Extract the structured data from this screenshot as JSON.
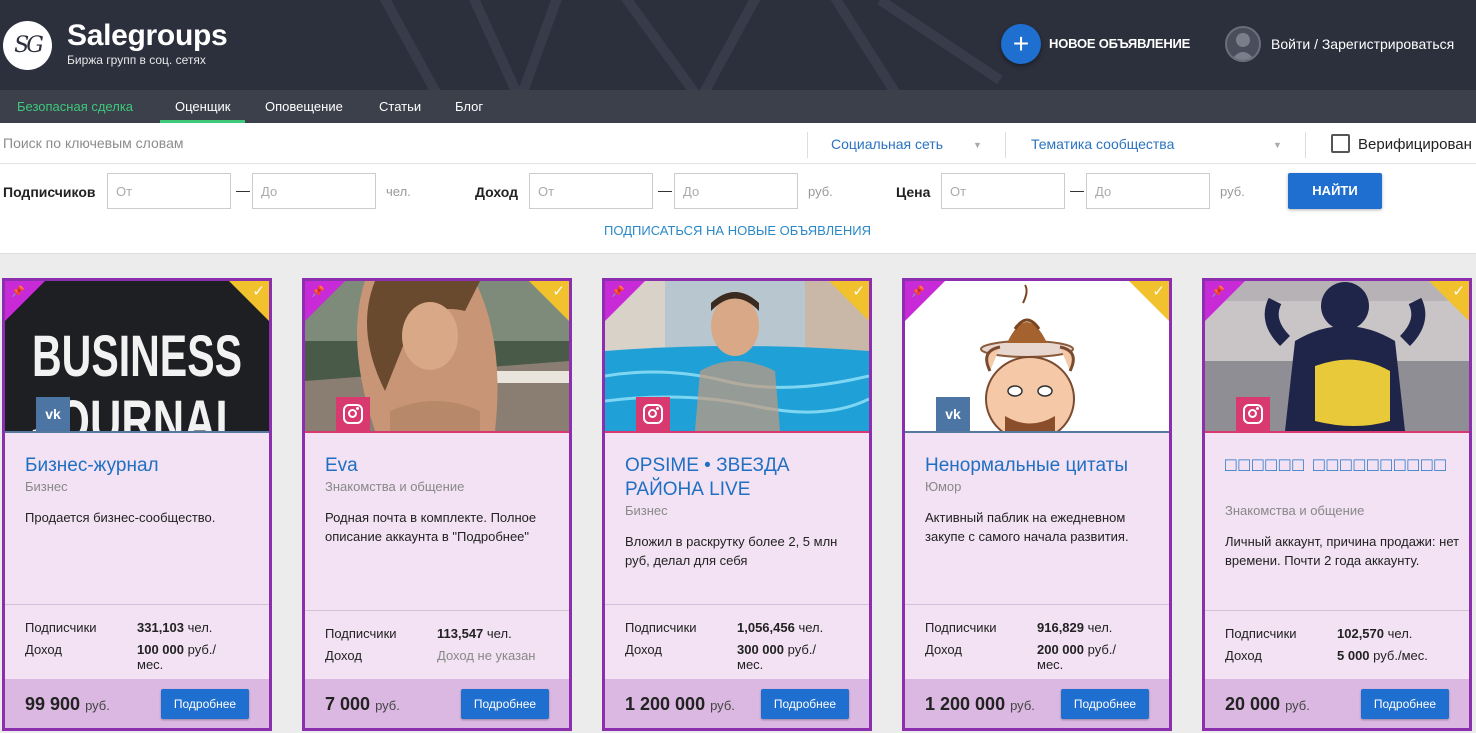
{
  "header": {
    "logo_text": "SG",
    "brand": "Salegroups",
    "tagline": "Биржа групп в соц. сетях",
    "new_ad_icon": "+",
    "new_ad_label": "НОВОЕ ОБЪЯВЛЕНИЕ",
    "login_label": "Войти / Зарегистрироваться"
  },
  "nav": {
    "items": [
      {
        "label": "Безопасная сделка"
      },
      {
        "label": "Оценщик"
      },
      {
        "label": "Оповещение"
      },
      {
        "label": "Статьи"
      },
      {
        "label": "Блог"
      }
    ]
  },
  "filters": {
    "search_placeholder": "Поиск по ключевым словам",
    "social_select": "Социальная сеть",
    "topic_select": "Тематика сообщества",
    "verified_label": "Верифицирован",
    "caret": "▼",
    "dash": "—",
    "subscribers": {
      "label": "Подписчиков",
      "from": "От",
      "to": "До",
      "unit": "чел."
    },
    "income": {
      "label": "Доход",
      "from": "От",
      "to": "До",
      "unit": "руб."
    },
    "price": {
      "label": "Цена",
      "from": "От",
      "to": "До",
      "unit": "руб."
    },
    "search_button": "НАЙТИ",
    "subscribe_link": "ПОДПИСАТЬСЯ НА НОВЫЕ ОБЪЯВЛЕНИЯ"
  },
  "card_labels": {
    "subscribers": "Подписчики",
    "income": "Доход",
    "more": "Подробнее",
    "currency": "руб.",
    "pin_icon": "📌",
    "check_icon": "✓"
  },
  "cards": [
    {
      "network": "vk",
      "network_icon": "vk",
      "title": "Бизнес-журнал",
      "category": "Бизнес",
      "description": "Продается бизнес-сообщество.",
      "subscribers": "331,103",
      "subscribers_unit": "чел.",
      "income": "100 000",
      "income_unit": "руб./ мес.",
      "price": "99 900",
      "image_text_1": "BUSINESS",
      "image_text_2": "JOURNAL"
    },
    {
      "network": "instagram",
      "network_icon": "instagram",
      "title": "Eva",
      "category": "Знакомства и общение",
      "description": "Родная почта в комплекте. Полное описание аккаунта в \"Подробнее\"",
      "subscribers": "113,547",
      "subscribers_unit": "чел.",
      "income": "Доход не указан",
      "income_unit": "",
      "price": "7 000"
    },
    {
      "network": "instagram",
      "network_icon": "instagram",
      "title": "OPSIME • ЗВЕЗДА РАЙОНА LIVE",
      "category": "Бизнес",
      "description": "Вложил в раскрутку более 2, 5 млн руб, делал для себя",
      "subscribers": "1,056,456",
      "subscribers_unit": "чел.",
      "income": "300 000",
      "income_unit": "руб./ мес.",
      "price": "1 200 000"
    },
    {
      "network": "vk",
      "network_icon": "vk",
      "title": "Ненормальные цитаты",
      "category": "Юмор",
      "description": "Активный паблик на ежедневном закупе с самого начала развития.",
      "subscribers": "916,829",
      "subscribers_unit": "чел.",
      "income": "200 000",
      "income_unit": "руб./ мес.",
      "price": "1 200 000"
    },
    {
      "network": "instagram",
      "network_icon": "instagram",
      "title": "□□□□□□ □□□□□□□□□□",
      "category": "Знакомства и общение",
      "description": "Личный аккаунт, причина продажи: нет времени. Почти 2 года аккаунту.",
      "subscribers": "102,570",
      "subscribers_unit": "чел.",
      "income": "5 000",
      "income_unit": "руб./мес.",
      "price": "20 000"
    }
  ]
}
